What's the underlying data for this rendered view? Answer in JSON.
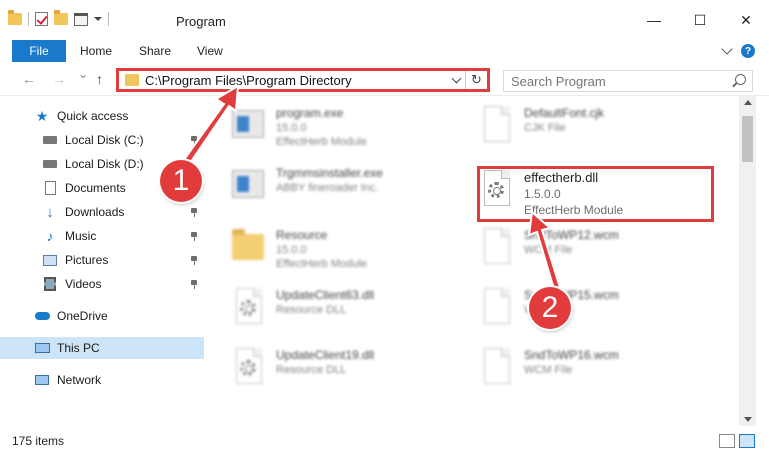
{
  "window": {
    "title": "Program",
    "minimize": "—",
    "maximize": "☐",
    "close": "✕"
  },
  "ribbon": {
    "file": "File",
    "home": "Home",
    "share": "Share",
    "view": "View",
    "help": "?"
  },
  "nav": {
    "back": "←",
    "forward": "→",
    "recent": "⌄",
    "up": "↑",
    "address": "C:\\Program Files\\Program Directory",
    "refresh": "↻",
    "search_placeholder": "Search Program"
  },
  "sidebar": {
    "items": [
      {
        "label": "Quick access",
        "icon": "star-icon"
      },
      {
        "label": "Local Disk (C:)",
        "icon": "drive-icon"
      },
      {
        "label": "Local Disk (D:)",
        "icon": "drive-icon"
      },
      {
        "label": "Documents",
        "icon": "documents-icon"
      },
      {
        "label": "Downloads",
        "icon": "download-icon"
      },
      {
        "label": "Music",
        "icon": "music-icon"
      },
      {
        "label": "Pictures",
        "icon": "pictures-icon"
      },
      {
        "label": "Videos",
        "icon": "videos-icon"
      },
      {
        "label": "OneDrive",
        "icon": "cloud-icon"
      },
      {
        "label": "This PC",
        "icon": "computer-icon"
      },
      {
        "label": "Network",
        "icon": "network-icon"
      }
    ]
  },
  "files": {
    "left": [
      {
        "name": "program.exe",
        "line2": "15.0.0",
        "line3": "EffectHerb Module"
      },
      {
        "name": "Trgmmsinstaller.exe",
        "line2": "ABBY fineroader Inc.",
        "line3": ""
      },
      {
        "name": "Resource",
        "line2": "15.0.0",
        "line3": "EffectHerb Module"
      },
      {
        "name": "UpdateClient63.dll",
        "line2": "Resource DLL",
        "line3": ""
      },
      {
        "name": "UpdateClient19.dll",
        "line2": "Resource DLL",
        "line3": ""
      }
    ],
    "right": [
      {
        "name": "DefaultFont.cjk",
        "line2": "CJK File",
        "line3": ""
      },
      {
        "name": "effectherb.dll",
        "line2": "1.5.0.0",
        "line3": "EffectHerb Module"
      },
      {
        "name": "SndToWP12.wcm",
        "line2": "WCM File",
        "line3": ""
      },
      {
        "name": "SndToWP15.wcm",
        "line2": "WCM File",
        "line3": ""
      },
      {
        "name": "SndToWP16.wcm",
        "line2": "WCM File",
        "line3": ""
      }
    ]
  },
  "status": {
    "items": "175 items"
  },
  "annotations": {
    "step1": "1",
    "step2": "2",
    "color": "#e23b3b"
  }
}
